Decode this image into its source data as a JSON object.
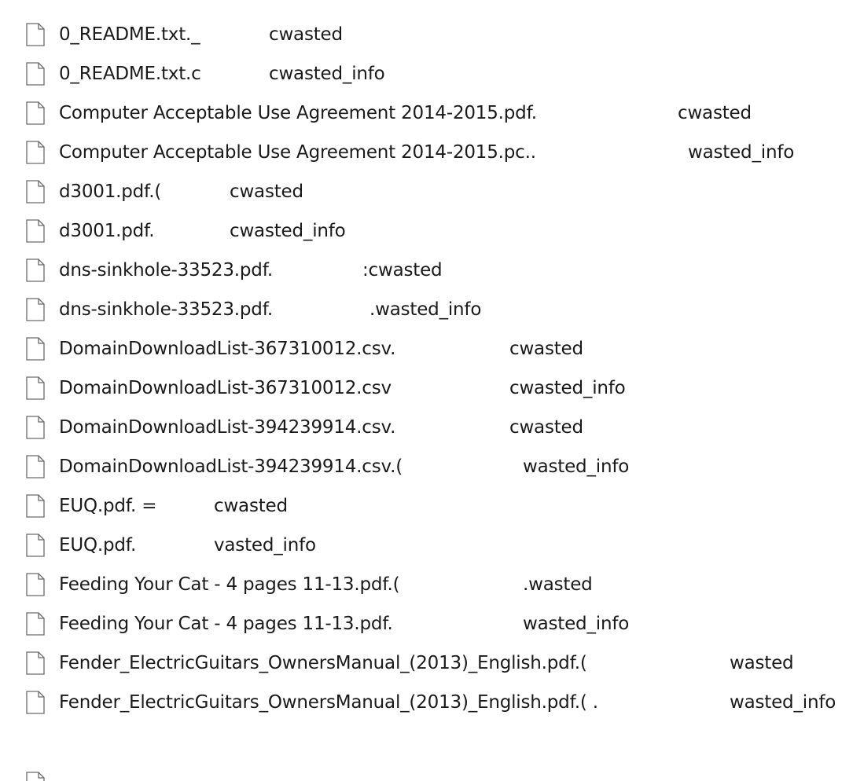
{
  "files": [
    {
      "name": "0_README.txt._",
      "suffix": "cwasted"
    },
    {
      "name": "0_README.txt.c",
      "suffix": "cwasted_info"
    },
    {
      "name": "Computer Acceptable Use Agreement 2014-2015.pdf.",
      "suffix": "cwasted"
    },
    {
      "name": "Computer Acceptable Use Agreement 2014-2015.pc..",
      "suffix": "wasted_info"
    },
    {
      "name": "d3001.pdf.(",
      "suffix": "cwasted"
    },
    {
      "name": "d3001.pdf.",
      "suffix": "cwasted_info"
    },
    {
      "name": "dns-sinkhole-33523.pdf.",
      "suffix": ":cwasted"
    },
    {
      "name": "dns-sinkhole-33523.pdf.",
      "suffix": ".wasted_info"
    },
    {
      "name": "DomainDownloadList-367310012.csv.",
      "suffix": "cwasted"
    },
    {
      "name": "DomainDownloadList-367310012.csv",
      "suffix": "cwasted_info"
    },
    {
      "name": "DomainDownloadList-394239914.csv.",
      "suffix": "cwasted"
    },
    {
      "name": "DomainDownloadList-394239914.csv.(",
      "suffix": "wasted_info"
    },
    {
      "name": "EUQ.pdf. =",
      "suffix": "cwasted"
    },
    {
      "name": "EUQ.pdf.",
      "suffix": "vasted_info"
    },
    {
      "name": "Feeding Your Cat - 4 pages 11-13.pdf.(",
      "suffix": ".wasted"
    },
    {
      "name": "Feeding Your Cat - 4 pages 11-13.pdf.",
      "suffix": "wasted_info"
    },
    {
      "name": "Fender_ElectricGuitars_OwnersManual_(2013)_English.pdf.(",
      "suffix": "wasted"
    },
    {
      "name": "Fender_ElectricGuitars_OwnersManual_(2013)_English.pdf.(  .",
      "suffix": "wasted_info"
    }
  ],
  "icons": {
    "file": "blank-file-icon"
  },
  "colors": {
    "text": "#1a1a1a",
    "icon_stroke": "#6b6b6b",
    "icon_fill": "#ffffff",
    "background": "#ffffff"
  }
}
